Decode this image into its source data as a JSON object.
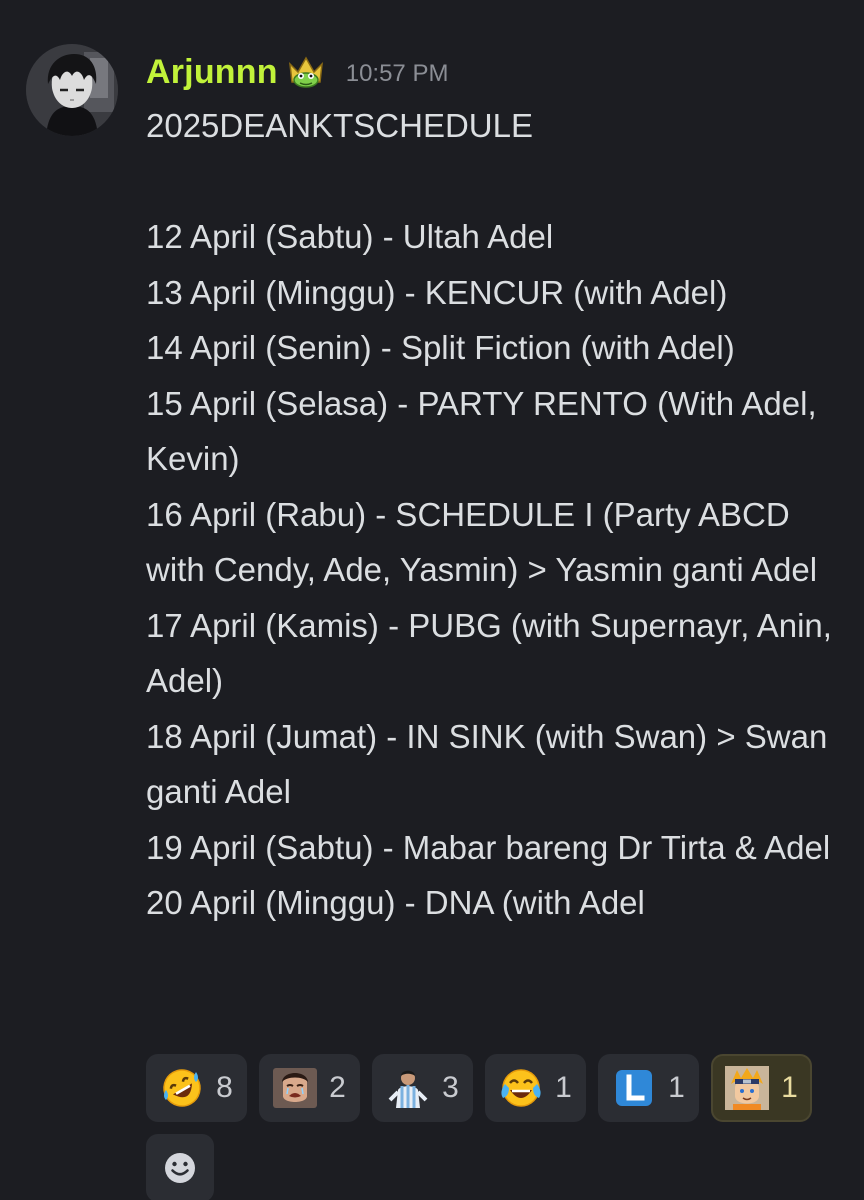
{
  "message": {
    "author": "Arjunnn",
    "author_color": "#c1f23a",
    "role_icon": "crown-frog-icon",
    "timestamp": "10:57 PM",
    "title": "2025DEANKTSCHEDULE",
    "lines": [
      "12 April (Sabtu) - Ultah Adel",
      "13 April (Minggu) - KENCUR (with Adel)",
      "14 April (Senin) - Split Fiction (with Adel)",
      "15 April (Selasa) - PARTY RENTO (With Adel, Kevin)",
      "16 April (Rabu) - SCHEDULE I (Party ABCD with Cendy, Ade, Yasmin) > Yasmin ganti Adel",
      "17 April (Kamis) - PUBG (with Supernayr, Anin, Adel)",
      "18 April (Jumat) - IN SINK (with Swan) > Swan ganti Adel",
      "19 April (Sabtu) - Mabar bareng Dr Tirta & Adel",
      "20 April (Minggu) - DNA (with Adel"
    ]
  },
  "reactions": [
    {
      "icon": "rofl-emoji-icon",
      "count": "8",
      "active": false
    },
    {
      "icon": "crying-person-sticker-icon",
      "count": "2",
      "active": false
    },
    {
      "icon": "soccer-player-sticker-icon",
      "count": "3",
      "active": false
    },
    {
      "icon": "joy-emoji-icon",
      "count": "1",
      "active": false
    },
    {
      "icon": "letter-l-emoji-icon",
      "count": "1",
      "active": false
    },
    {
      "icon": "naruto-sticker-icon",
      "count": "1",
      "active": true
    }
  ],
  "add_reaction_icon": "smiley-add-reaction-icon"
}
